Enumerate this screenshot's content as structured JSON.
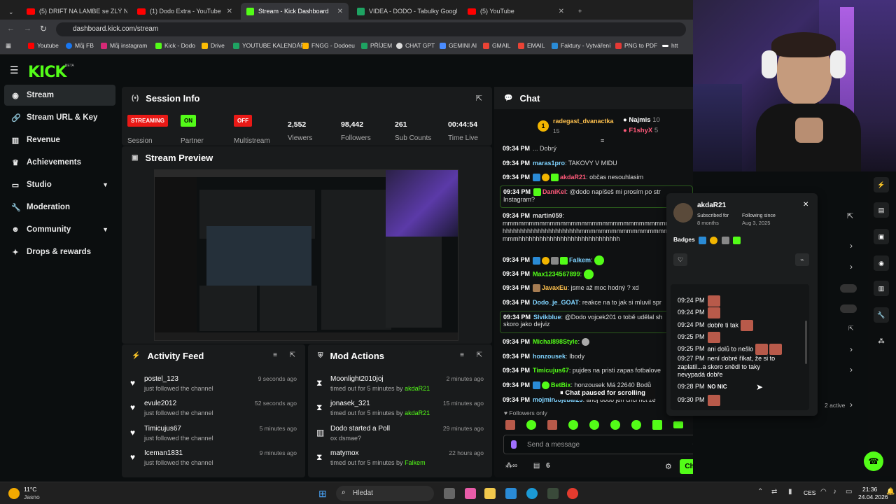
{
  "browser": {
    "tabs": [
      {
        "title": "(5) DRIFT NA LAMBE se ZLÝ N..."
      },
      {
        "title": "(1) Dodo Extra - YouTube"
      },
      {
        "title": "Stream - Kick Dashboard"
      },
      {
        "title": "VIDEA - DODO - Tabulky Googl..."
      },
      {
        "title": "(5) YouTube"
      }
    ],
    "url": "dashboard.kick.com/stream",
    "bookmarks": [
      "Youtube",
      "Můj FB",
      "Můj instagram",
      "Kick - Dodo",
      "Drive",
      "YOUTUBE KALENDÁŘ",
      "FNGG - Dodoeu",
      "PŘÍJEM",
      "CHAT GPT",
      "GEMINI AI",
      "GMAIL",
      "EMAIL",
      "Faktury - Vytváření",
      "PNG to PDF",
      "htt"
    ]
  },
  "kick": {
    "logo": "KICK",
    "beta": "BETA"
  },
  "sidebar": {
    "items": [
      {
        "label": "Stream",
        "icon": "broadcast-icon"
      },
      {
        "label": "Stream URL & Key",
        "icon": "link-icon"
      },
      {
        "label": "Revenue",
        "icon": "chart-icon"
      },
      {
        "label": "Achievements",
        "icon": "trophy-icon"
      },
      {
        "label": "Studio",
        "icon": "monitor-icon"
      },
      {
        "label": "Moderation",
        "icon": "wrench-icon"
      },
      {
        "label": "Community",
        "icon": "people-icon"
      },
      {
        "label": "Drops & rewards",
        "icon": "gift-icon"
      }
    ]
  },
  "session": {
    "title": "Session Info",
    "session_badge": "STREAMING",
    "session_label": "Session",
    "partner_badge": "ON",
    "partner_label": "Partner",
    "multistream_badge": "OFF",
    "multistream_label": "Multistream",
    "viewers": "2,552",
    "viewers_label": "Viewers",
    "followers": "98,442",
    "followers_label": "Followers",
    "subs": "261",
    "subs_label": "Sub Counts",
    "time": "00:44:54",
    "time_label": "Time Live"
  },
  "preview": {
    "title": "Stream Preview"
  },
  "activity": {
    "title": "Activity Feed",
    "items": [
      {
        "user": "postel_123",
        "action": "just followed the channel",
        "time": "9 seconds ago"
      },
      {
        "user": "evule2012",
        "action": "just followed the channel",
        "time": "52 seconds ago"
      },
      {
        "user": "Timicujus67",
        "action": "just followed the channel",
        "time": "5 minutes ago"
      },
      {
        "user": "Iceman1831",
        "action": "just followed the channel",
        "time": "9 minutes ago"
      }
    ]
  },
  "mod": {
    "title": "Mod Actions",
    "items": [
      {
        "user": "Moonlight2010joj",
        "pre": "timed out for 5 minutes by ",
        "by": "akdaR21",
        "time": "2 minutes ago"
      },
      {
        "user": "jonasek_321",
        "pre": "timed out for 5 minutes by ",
        "by": "akdaR21",
        "time": "15 minutes ago"
      },
      {
        "user": "Dodo started a Poll",
        "pre": "ox dsmae?",
        "by": "",
        "time": "29 minutes ago"
      },
      {
        "user": "matymox",
        "pre": "timed out for 5 minutes by ",
        "by": "Falkem",
        "time": "22 hours ago"
      }
    ]
  },
  "chat": {
    "title": "Chat",
    "top_gifter": "radegast_dvanactka",
    "top_gifter_count": "15",
    "g2": "Najmis",
    "g2_count": "10",
    "g3": "F1shyX",
    "g3_count": "5",
    "messages": [
      {
        "time": "09:34 PM",
        "user": "maras1pro",
        "text": "TAKOVY V MIDU",
        "color": "#7fd3ff"
      },
      {
        "time": "09:34 PM",
        "user": "akdaR21",
        "text": "občas nesouhlasim",
        "color": "#ff5a7a"
      },
      {
        "time": "09:34 PM",
        "user": "DaniKel",
        "text": "@dodo napíšeš mi prosím po str",
        "text2": "Instagram?",
        "color": "#ff5a7a"
      },
      {
        "time": "09:34 PM",
        "user": "martin059",
        "text": "",
        "text2": "mmmmmmmmmmmmmmmmmmmmmmmmmmmmmmmmhhhhhh",
        "text3": "hhhhhhhhhhhhhhhhhhhhhhmmmmmmmmmmmmmmmmmm",
        "text4": "mmmhhhhhhhhhhhhhhhhhhhhhhhhhhhhh",
        "color": "#ffffff"
      },
      {
        "time": "09:34 PM",
        "user": "Falkem",
        "text": "",
        "color": "#7fd3ff"
      },
      {
        "time": "09:34 PM",
        "user": "Max1234567899",
        "text": "",
        "color": "#53fc18"
      },
      {
        "time": "09:34 PM",
        "user": "JavaxEu",
        "text": "jsme až moc hodný ? xd",
        "color": "#ffc14d"
      },
      {
        "time": "09:34 PM",
        "user": "Dodo_je_GOAT",
        "text": "reakce na to jak si mluvil spr",
        "color": "#7fd3ff"
      },
      {
        "time": "09:34 PM",
        "user": "Slvikblue",
        "text": "@Dodo vojcek201 o tobě udělal sh",
        "text2": "skoro jako dejviz",
        "color": "#7fd3ff"
      },
      {
        "time": "09:34 PM",
        "user": "Michal898Style",
        "text": "",
        "color": "#53fc18"
      },
      {
        "time": "09:34 PM",
        "user": "honzousek",
        "text": "Ibody",
        "color": "#7fd3ff"
      },
      {
        "time": "09:34 PM",
        "user": "Timicujus67",
        "text": "pujdes na pristi zapas fotbalove",
        "color": "#53fc18"
      },
      {
        "time": "09:34 PM",
        "user": "BetBix",
        "text": "honzousek Má 22640 Bodů",
        "color": "#53fc18"
      },
      {
        "time": "09:34 PM",
        "user": "mojmirdojebal23",
        "text": "ahoj dodo jen chci rict ze",
        "color": "#7fd3ff"
      }
    ],
    "paused": "Chat paused for scrolling",
    "followers_only": "Followers only",
    "placeholder": "Send a message",
    "send": "Chat",
    "count": "6"
  },
  "usercard": {
    "name": "akdaR21",
    "sub_label": "Subscribed for",
    "sub_value": "8 months",
    "follow_label": "Following since",
    "follow_value": "Aug 3, 2025",
    "badges_label": "Badges",
    "history": [
      {
        "time": "09:24 PM",
        "text": ""
      },
      {
        "time": "09:24 PM",
        "text": ""
      },
      {
        "time": "09:24 PM",
        "text": "dobře ti tak"
      },
      {
        "time": "09:25 PM",
        "text": ""
      },
      {
        "time": "09:25 PM",
        "text": "ani dolů to nešlo"
      },
      {
        "time": "09:27 PM",
        "text": "není dobré říkat, že si to"
      },
      {
        "time": "",
        "text": "zaplatil...a skoro snědl    to taky"
      },
      {
        "time": "",
        "text": "nevypadá dobře"
      },
      {
        "time": "09:28 PM",
        "text": "NO NIC"
      },
      {
        "time": "09:30 PM",
        "text": ""
      }
    ]
  },
  "right": {
    "active": "2 active"
  },
  "taskbar": {
    "temp": "11°C",
    "weather": "Jasno",
    "search": "Hledat",
    "lang": "CES",
    "clock": "21:36",
    "date": "24.04.2026"
  },
  "colors": {
    "accent": "#53fc18",
    "bg": "#0b0e0f",
    "panel": "#191b1c",
    "streaming": "#e91916",
    "off": "#e91916"
  }
}
